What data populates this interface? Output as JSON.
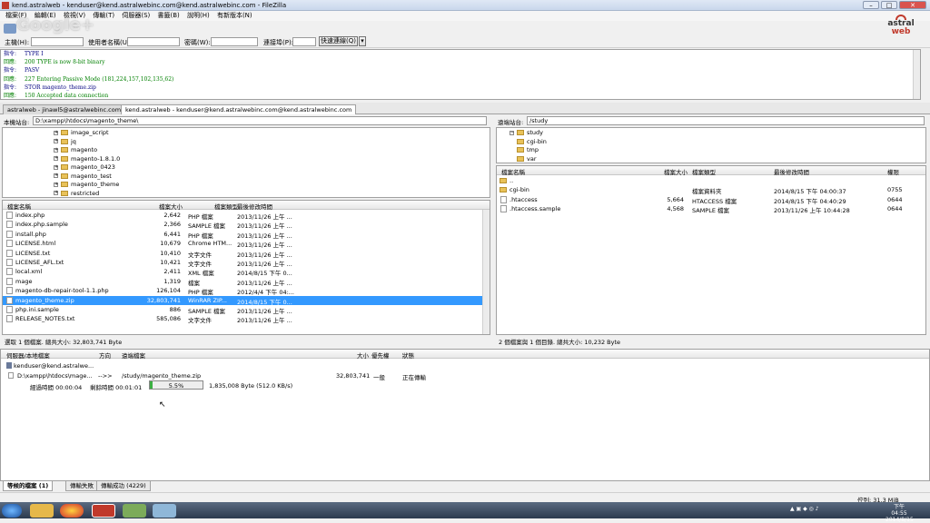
{
  "window": {
    "title": "kend.astralweb - kenduser@kend.astralwebinc.com@kend.astralwebinc.com - FileZilla",
    "buttons": {
      "minimize": "–",
      "maximize": "□",
      "close": "✕"
    }
  },
  "watermark": "Google+",
  "logo": {
    "line1": "astral",
    "line2": "web"
  },
  "menu": [
    "檔案(F)",
    "編輯(E)",
    "檢視(V)",
    "傳輸(T)",
    "伺服器(S)",
    "書籤(B)",
    "說明(H)",
    "有新版本(N)"
  ],
  "quickconnect": {
    "host_label": "主機(H):",
    "user_label": "使用者名稱(U):",
    "pass_label": "密碼(W):",
    "port_label": "連接埠(P):",
    "connect_label": "快速連線(Q)"
  },
  "log": [
    {
      "type": "指令:",
      "text": "TYPE I",
      "color": "#000080"
    },
    {
      "type": "回應:",
      "text": "200 TYPE is now 8-bit binary",
      "color": "#008000"
    },
    {
      "type": "指令:",
      "text": "PASV",
      "color": "#000080"
    },
    {
      "type": "回應:",
      "text": "227 Entering Passive Mode (181,224,157,102,135,62)",
      "color": "#008000"
    },
    {
      "type": "指令:",
      "text": "STOR magento_theme.zip",
      "color": "#000080"
    },
    {
      "type": "回應:",
      "text": "150 Accepted data connection",
      "color": "#008000"
    }
  ],
  "tabs": [
    {
      "label": "astralweb - jinawl5@astralwebinc.com",
      "active": false
    },
    {
      "label": "kend.astralweb - kenduser@kend.astralwebinc.com@kend.astralwebinc.com",
      "active": true
    }
  ],
  "local": {
    "site_label": "本機站台:",
    "path": "D:\\xampp\\htdocs\\magento_theme\\",
    "tree": [
      "image_script",
      "jq",
      "magento",
      "magento-1.8.1.0",
      "magento_0423",
      "magento_test",
      "magento_theme",
      "restricted"
    ],
    "headers": [
      "檔案名稱",
      "檔案大小",
      "檔案類型",
      "最後修改時間"
    ],
    "files": [
      {
        "name": "index.php",
        "size": "2,642",
        "type": "PHP 檔案",
        "date": "2013/11/26 上午 ...",
        "selected": false
      },
      {
        "name": "index.php.sample",
        "size": "2,366",
        "type": "SAMPLE 檔案",
        "date": "2013/11/26 上午 ...",
        "selected": false
      },
      {
        "name": "install.php",
        "size": "6,441",
        "type": "PHP 檔案",
        "date": "2013/11/26 上午 ...",
        "selected": false
      },
      {
        "name": "LICENSE.html",
        "size": "10,679",
        "type": "Chrome HTM...",
        "date": "2013/11/26 上午 ...",
        "selected": false
      },
      {
        "name": "LICENSE.txt",
        "size": "10,410",
        "type": "文字文件",
        "date": "2013/11/26 上午 ...",
        "selected": false
      },
      {
        "name": "LICENSE_AFL.txt",
        "size": "10,421",
        "type": "文字文件",
        "date": "2013/11/26 上午 ...",
        "selected": false
      },
      {
        "name": "local.xml",
        "size": "2,411",
        "type": "XML 檔案",
        "date": "2014/8/15 下午 0...",
        "selected": false
      },
      {
        "name": "mage",
        "size": "1,319",
        "type": "檔案",
        "date": "2013/11/26 上午 ...",
        "selected": false
      },
      {
        "name": "magento-db-repair-tool-1.1.php",
        "size": "126,104",
        "type": "PHP 檔案",
        "date": "2012/4/4 下午 04:...",
        "selected": false
      },
      {
        "name": "magento_theme.zip",
        "size": "32,803,741",
        "type": "WinRAR ZIP...",
        "date": "2014/8/15 下午 0...",
        "selected": true
      },
      {
        "name": "php.ini.sample",
        "size": "886",
        "type": "SAMPLE 檔案",
        "date": "2013/11/26 上午 ...",
        "selected": false
      },
      {
        "name": "RELEASE_NOTES.txt",
        "size": "585,086",
        "type": "文字文件",
        "date": "2013/11/26 上午 ...",
        "selected": false
      }
    ],
    "status": "選取 1 個檔案. 總共大小: 32,803,741 Byte"
  },
  "remote": {
    "site_label": "遠端站台:",
    "path": "/study",
    "tree": [
      "study",
      "cgi-bin",
      "tmp",
      "var"
    ],
    "headers": [
      "檔案名稱",
      "檔案大小",
      "檔案類型",
      "最後修改時間",
      "權限"
    ],
    "files": [
      {
        "name": "..",
        "size": "",
        "type": "",
        "date": "",
        "perm": ""
      },
      {
        "name": "cgi-bin",
        "size": "",
        "type": "檔案資料夾",
        "date": "2014/8/15 下午 04:00:37",
        "perm": "0755"
      },
      {
        "name": ".htaccess",
        "size": "5,664",
        "type": "HTACCESS 檔案",
        "date": "2014/8/15 下午 04:40:29",
        "perm": "0644"
      },
      {
        "name": ".htaccess.sample",
        "size": "4,568",
        "type": "SAMPLE 檔案",
        "date": "2013/11/26 上午 10:44:28",
        "perm": "0644"
      }
    ],
    "status": "2 個檔案與 1 個目錄. 總共大小: 10,232 Byte"
  },
  "queue": {
    "headers": [
      "伺服器/本地檔案",
      "方向",
      "遠端檔案",
      "大小",
      "優先權",
      "狀態"
    ],
    "server": "kenduser@kend.astralwe...",
    "local_file": "D:\\xampp\\htdocs\\mage...",
    "direction": "-->>",
    "remote_file": "/study/magento_theme.zip",
    "size": "32,803,741",
    "priority": "一般",
    "status": "正在傳輸",
    "elapsed": "經過時間 00:00:04",
    "remaining": "剩餘時間 00:01:01",
    "progress": 5.5,
    "progress_label": "5.5%",
    "rate": "1,835,008 Byte (512.0 KB/s)"
  },
  "queue_tabs": [
    "等候的檔案 (1)",
    "傳輸失敗",
    "傳輸成功 (4229)"
  ],
  "status_bar": {
    "queue": "佇列: 31.3 MiB"
  },
  "taskbar": {
    "time": "下午 04:55",
    "date": "2014/8/15"
  }
}
